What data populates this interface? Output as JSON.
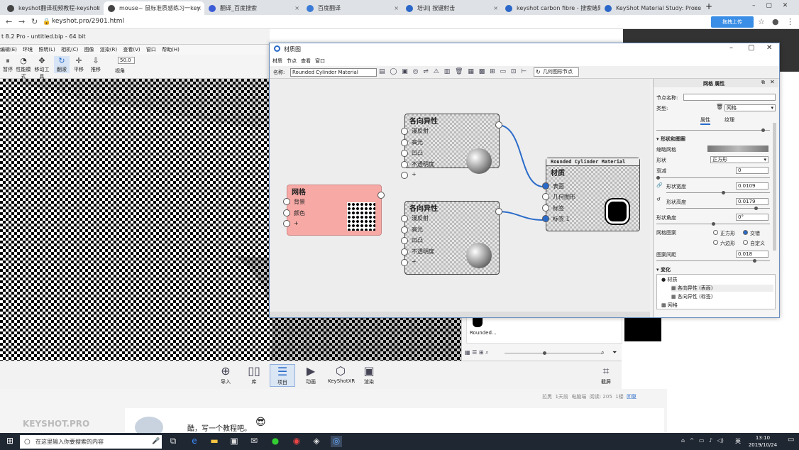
{
  "tabs": [
    {
      "label": "keyshot翻译视频教程-keyshot"
    },
    {
      "label": "mouse~ 鼠标准质感练习一key"
    },
    {
      "label": "翻译_百度搜索"
    },
    {
      "label": "百度翻译"
    },
    {
      "label": "培训| 按键射击"
    },
    {
      "label": "keyshot carbon fibre - 搜索结果"
    },
    {
      "label": "KeyShot Material Study: Proce"
    }
  ],
  "browser": {
    "url": "keyshot.pro/2901.html",
    "upload_label": "拖拽上传"
  },
  "keyshot": {
    "title": "t 8.2 Pro - untitled.bip - 64 bit",
    "menu": [
      "编辑(E)",
      "环境",
      "照明(L)",
      "相机(C)",
      "图像",
      "渲染(R)",
      "查看(V)",
      "窗口",
      "帮助(H)"
    ],
    "toolbar": [
      {
        "label": "暂停",
        "icon": "pause-icon"
      },
      {
        "label": "性能模式",
        "icon": "gauge-icon"
      },
      {
        "label": "移动工具",
        "icon": "move-icon"
      },
      {
        "label": "翻滚",
        "icon": "rotate-icon"
      },
      {
        "label": "平移",
        "icon": "pan-icon"
      },
      {
        "label": "推移",
        "icon": "dolly-icon"
      },
      {
        "label": "视角",
        "icon": "fov-icon"
      }
    ],
    "fov_value": "50.0",
    "bottom": [
      {
        "label": "导入"
      },
      {
        "label": "库"
      },
      {
        "label": "项目"
      },
      {
        "label": "动画"
      },
      {
        "label": "KeyShotXR"
      },
      {
        "label": "渲染"
      }
    ],
    "screenshot_label": "截屏",
    "library_item": "Rounded..."
  },
  "forum": {
    "meta": [
      "拉黑",
      "1天前",
      "电脑端",
      "阅读: 205",
      "1楼",
      "回复"
    ],
    "comment": "酷，写一个教程吧。",
    "watermark": "KEYSHOT.PRO"
  },
  "matwin": {
    "title": "材质图",
    "menu": [
      "材质",
      "节点",
      "查看",
      "窗口"
    ],
    "name_label": "名称:",
    "name_value": "Rounded Cylinder Material",
    "geo_node_label": "几何图形节点",
    "nodes": {
      "aniso1": {
        "title": "各向异性",
        "rows": [
          "漫反射",
          "高光",
          "凹凸",
          "不透明度",
          "+"
        ]
      },
      "aniso2": {
        "title": "各向异性",
        "rows": [
          "漫反射",
          "高光",
          "凹凸",
          "不透明度",
          "+"
        ]
      },
      "mesh": {
        "title": "网格",
        "rows": [
          "背景",
          "颜色",
          "+"
        ]
      },
      "output": {
        "header": "Rounded Cylinder Material",
        "title": "材质",
        "rows": [
          "表面",
          "几何图形",
          "标签",
          "标签 1"
        ]
      }
    },
    "props": {
      "header": "网格 属性",
      "node_name_label": "节点名称:",
      "type_label": "类型:",
      "type_value": "网格",
      "tab_props": "属性",
      "tab_texture": "纹理",
      "section": "形状和图案",
      "thumb_label": "缩略网格",
      "shape_label": "形状",
      "shape_value": "正方形",
      "attenuation_label": "衰减",
      "attenuation_value": "0",
      "width_label": "形状宽度",
      "width_value": "0.0109",
      "height_label": "形状高度",
      "height_value": "0.0179",
      "angle_label": "形状角度",
      "angle_value": "0°",
      "pattern_label": "网格图案",
      "pattern_opts": [
        "正方形",
        "交错",
        "六边形",
        "自定义"
      ],
      "spacing_label": "图案间距",
      "spacing_value": "0.018",
      "tree_header": "变化",
      "tree": [
        "材质",
        "各向异性 (表面)",
        "各向异性 (标签)",
        "网格"
      ]
    }
  },
  "taskbar": {
    "search_placeholder": "在这里输入你要搜索的内容",
    "time": "13:10",
    "date": "2019/10/24",
    "lang": "英"
  }
}
